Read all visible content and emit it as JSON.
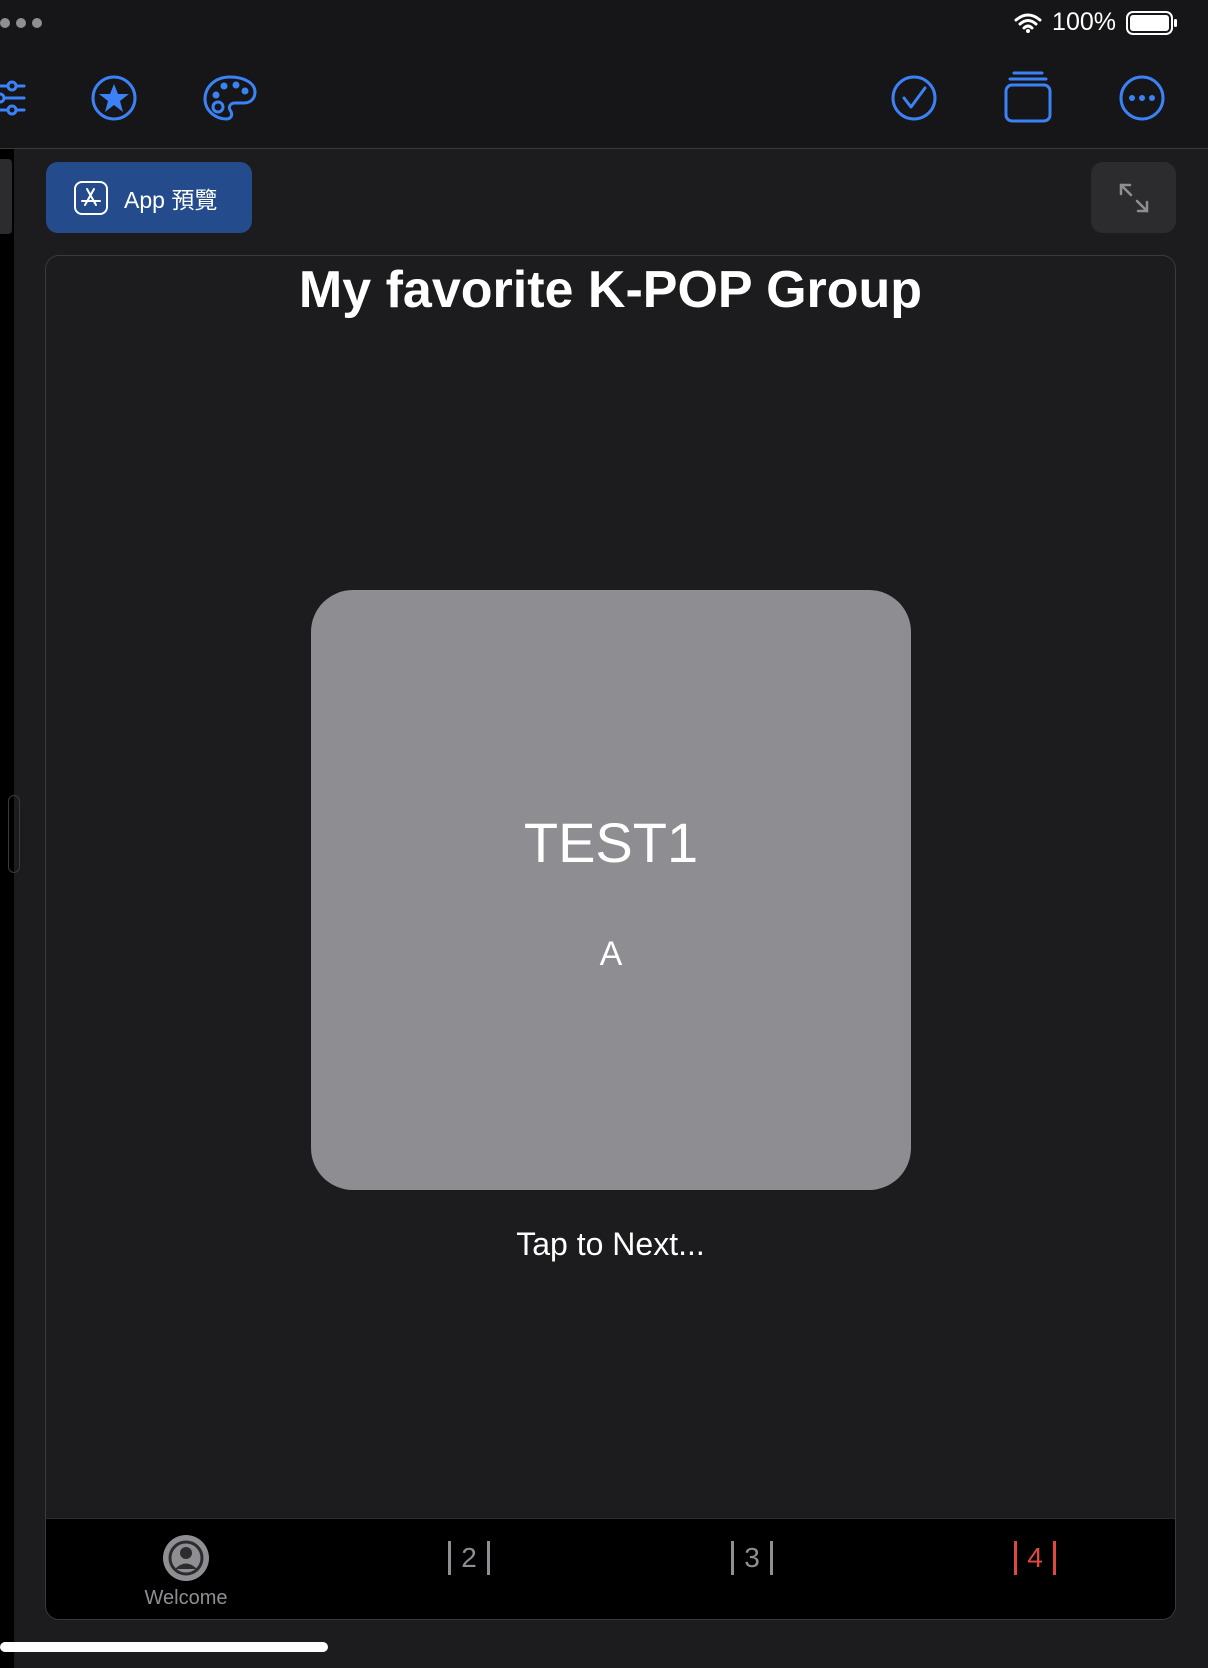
{
  "status": {
    "battery": "100%"
  },
  "toolbar": {
    "icons": [
      "sliders-icon",
      "star-icon",
      "palette-icon",
      "checkmark-icon",
      "stack-icon",
      "more-icon"
    ],
    "accent": "#3b82f6"
  },
  "preview_button": {
    "label": "App 預覽"
  },
  "main": {
    "title": "My favorite K-POP Group",
    "card": {
      "title": "TEST1",
      "subtitle": "A",
      "color": "#8e8d92"
    },
    "hint": "Tap to Next..."
  },
  "tabs": [
    {
      "label": "Welcome"
    },
    {
      "label": "2"
    },
    {
      "label": "3"
    },
    {
      "label": "4",
      "active": true,
      "color": "#e0493b"
    }
  ]
}
